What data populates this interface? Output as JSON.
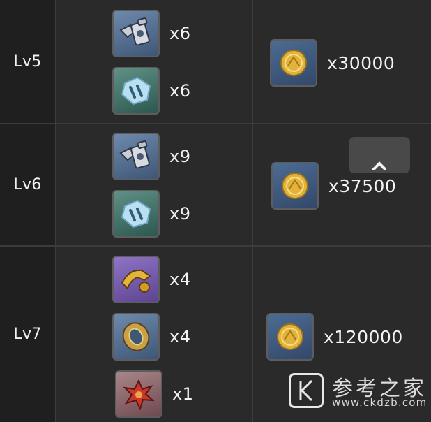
{
  "rows": [
    {
      "level": "Lv5",
      "materials": [
        {
          "icon": "gun-oil-icon",
          "quantity": "x6"
        },
        {
          "icon": "crystal-shard-icon",
          "quantity": "x6"
        }
      ],
      "cost": {
        "icon": "mora-coin-icon",
        "quantity": "x30000"
      }
    },
    {
      "level": "Lv6",
      "materials": [
        {
          "icon": "gun-oil-icon",
          "quantity": "x9"
        },
        {
          "icon": "crystal-shard-icon",
          "quantity": "x9"
        }
      ],
      "cost": {
        "icon": "mora-coin-icon",
        "quantity": "x37500"
      }
    },
    {
      "level": "Lv7",
      "materials": [
        {
          "icon": "golden-horn-icon",
          "quantity": "x4"
        },
        {
          "icon": "ornate-guard-icon",
          "quantity": "x4"
        },
        {
          "icon": "red-flower-icon",
          "quantity": "x1"
        }
      ],
      "cost": {
        "icon": "mora-coin-icon",
        "quantity": "x120000"
      }
    }
  ],
  "scroll_up": {
    "icon": "chevron-up-icon"
  },
  "watermark": {
    "logo": "K",
    "chinese": "参考之家",
    "url": "www.ckdzb.com"
  },
  "colors": {
    "background": "#2a2a2a",
    "level_column": "#1f1f1f",
    "grid_line": "#3c3c3c",
    "text": "#f3f3f3"
  }
}
